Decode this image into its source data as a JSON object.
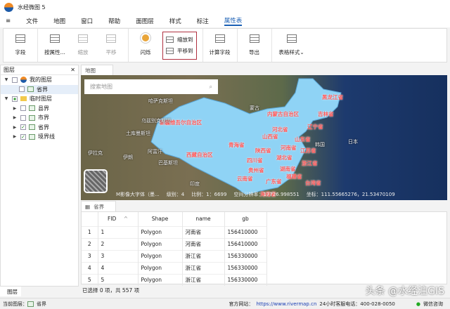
{
  "app": {
    "title": "水经微图 5"
  },
  "menu": [
    "文件",
    "地图",
    "窗口",
    "帮助",
    "面图层",
    "样式",
    "标注",
    "属性表"
  ],
  "ribbon": {
    "field": "字段",
    "by_attr": "按属性...",
    "zoom": "缩放",
    "pan": "平移",
    "flash": "闪烁",
    "zoom_to": "缩放到",
    "pan_to": "平移到",
    "calc_field": "计算字段",
    "export": "导出",
    "table_style": "表格样式"
  },
  "layers": {
    "title": "图层",
    "my_layers": "我的图层",
    "my_province": "省界",
    "temp_layers": "临时图层",
    "county": "县界",
    "city": "市界",
    "province": "省界",
    "border": "境界线"
  },
  "map": {
    "tab": "地图",
    "search_placeholder": "搜索地图",
    "provinces": [
      "黑龙江省",
      "吉林省",
      "内蒙古自治区",
      "辽宁省",
      "新疆维吾尔自治区",
      "河北省",
      "山西省",
      "山东省",
      "青海省",
      "陕西省",
      "河南省",
      "江苏省",
      "西藏自治区",
      "湖北省",
      "四川省",
      "浙江省",
      "贵州省",
      "湖南省",
      "福建省",
      "云南省",
      "广东省",
      "台湾省",
      "海南省"
    ],
    "foreign": [
      "哈萨克斯坦",
      "蒙古",
      "乌兹别克斯坦",
      "土库曼斯坦",
      "伊拉克",
      "伊朗",
      "阿富汗",
      "巴基斯坦",
      "印度",
      "日本",
      "韩国"
    ],
    "status": {
      "source": "M影像大字体（墨...",
      "level": "级别：4",
      "scale": "比例：1：6699",
      "resolution": "空间分辨率：17726.998551",
      "coords": "坐标：111.55665276，21.53470109"
    }
  },
  "table": {
    "tab": "省界",
    "columns": [
      "FID",
      "Shape",
      "name",
      "gb"
    ],
    "rows": [
      [
        "1",
        "1",
        "Polygon",
        "河南省",
        "156410000"
      ],
      [
        "2",
        "2",
        "Polygon",
        "河南省",
        "156410000"
      ],
      [
        "3",
        "3",
        "Polygon",
        "浙江省",
        "156330000"
      ],
      [
        "4",
        "4",
        "Polygon",
        "浙江省",
        "156330000"
      ],
      [
        "5",
        "5",
        "Polygon",
        "浙江省",
        "156330000"
      ]
    ],
    "selection": "已选择 0 项，共 557 项"
  },
  "left_tab": "图层",
  "status": {
    "current_layer_label": "当前图层：",
    "current_layer": "省界",
    "website_label": "官方网站：",
    "website": "https://www.rivermap.cn",
    "hotline": "24小时客服电话：400-028-0050",
    "wechat": "微信咨询"
  },
  "watermark": "头条 @水经注GIS"
}
